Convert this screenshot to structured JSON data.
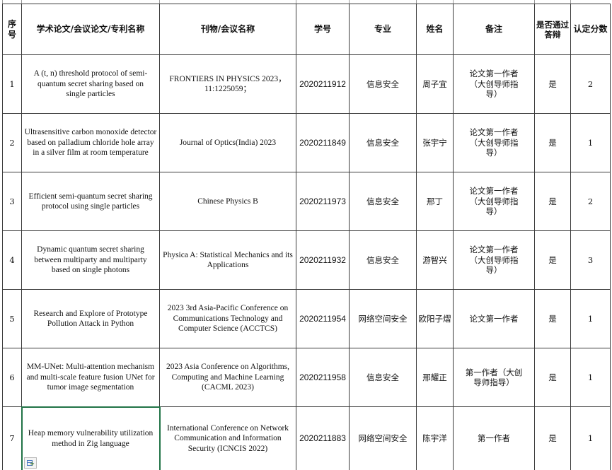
{
  "sheet": {
    "headers": {
      "index": "序号",
      "title": "学术论文/会议论文/专利名称",
      "venue": "刊物/会议名称",
      "student_id": "学号",
      "major": "专业",
      "name": "姓名",
      "remark": "备注",
      "passed_defense": "是否通过答辩",
      "score": "认定分数"
    },
    "rows": [
      {
        "index": "1",
        "title": "A (t, n) threshold protocol of semi-quantum secret sharing based on single particles",
        "venue": "FRONTIERS IN PHYSICS 2023，11:1225059；",
        "student_id": "2020211912",
        "major": "信息安全",
        "name": "周子宜",
        "remark": "论文第一作者（大创导师指导）",
        "passed_defense": "是",
        "score": "2"
      },
      {
        "index": "2",
        "title": "Ultrasensitive carbon monoxide detector based on palladium chloride hole array in a silver film at room temperature",
        "venue": "Journal of Optics(India) 2023",
        "student_id": "2020211849",
        "major": "信息安全",
        "name": "张宇宁",
        "remark": "论文第一作者（大创导师指导）",
        "passed_defense": "是",
        "score": "1"
      },
      {
        "index": "3",
        "title": "Efficient semi-quantum secret sharing protocol using single particles",
        "venue": "Chinese Physics B",
        "student_id": "2020211973",
        "major": "信息安全",
        "name": "邢丁",
        "remark": "论文第一作者（大创导师指导）",
        "passed_defense": "是",
        "score": "2"
      },
      {
        "index": "4",
        "title": "Dynamic quantum secret sharing between multiparty and multiparty based on single photons",
        "venue": "Physica A: Statistical Mechanics and its Applications",
        "student_id": "2020211932",
        "major": "信息安全",
        "name": "游智兴",
        "remark": "论文第一作者（大创导师指导）",
        "passed_defense": "是",
        "score": "3"
      },
      {
        "index": "5",
        "title": "Research and Explore of Prototype Pollution Attack in Python",
        "venue": "2023 3rd Asia-Pacific Conference on Communications Technology and Computer Science (ACCTCS)",
        "student_id": "2020211954",
        "major": "网络空间安全",
        "name": "欧阳子熠",
        "remark": "论文第一作者",
        "passed_defense": "是",
        "score": "1"
      },
      {
        "index": "6",
        "title": "MM-UNet: Multi-attention mechanism and multi-scale feature fusion UNet for tumor image segmentation",
        "venue": "2023 Asia Conference on Algorithms, Computing and Machine Learning (CACML 2023)",
        "student_id": "2020211958",
        "major": "信息安全",
        "name": "邢耀正",
        "remark": "第一作者（大创导师指导）",
        "passed_defense": "是",
        "score": "1"
      },
      {
        "index": "7",
        "title": "Heap memory vulnerability utilization method in Zig language",
        "venue": "International Conference on Network Communication and Information Security (ICNCIS 2022)",
        "student_id": "2020211883",
        "major": "网络空间安全",
        "name": "陈宇洋",
        "remark": "第一作者",
        "passed_defense": "是",
        "score": "1"
      }
    ]
  },
  "icons": {
    "quick_analysis": "quick-analysis-icon"
  },
  "colors": {
    "grid_border": "#3a3a3a",
    "selection": "#217346"
  }
}
